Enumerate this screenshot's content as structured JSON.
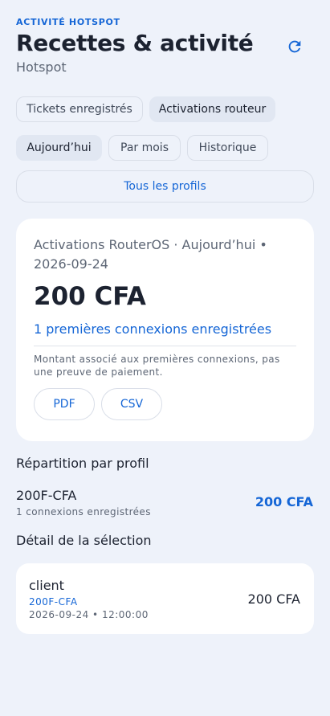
{
  "header": {
    "overline": "ACTIVITÉ HOTSPOT",
    "title": "Recettes & activité",
    "subtitle": "Hotspot",
    "refresh_icon": "refresh-icon"
  },
  "source_tabs": [
    {
      "label": "Tickets enregistrés",
      "active": false
    },
    {
      "label": "Activations routeur",
      "active": true
    }
  ],
  "period_tabs": [
    {
      "label": "Aujourd’hui",
      "active": true
    },
    {
      "label": "Par mois",
      "active": false
    },
    {
      "label": "Historique",
      "active": false
    }
  ],
  "profile_filter": "Tous les profils",
  "summary": {
    "heading": "Activations RouterOS · Aujourd’hui • 2026-09-24",
    "amount": "200 CFA",
    "count_text": "1 premières connexions enregistrées",
    "note": "Montant associé aux premières connexions, pas une preuve de paiement.",
    "export_pdf": "PDF",
    "export_csv": "CSV"
  },
  "breakdown": {
    "title": "Répartition par profil",
    "rows": [
      {
        "profile": "200F-CFA",
        "count_text": "1 connexions enregistrées",
        "amount": "200 CFA"
      }
    ]
  },
  "details": {
    "title": "Détail de la sélection",
    "rows": [
      {
        "user": "client",
        "profile": "200F-CFA",
        "timestamp": "2026-09-24 • 12:00:00",
        "amount": "200 CFA"
      }
    ]
  },
  "colors": {
    "accent": "#1566d6",
    "background": "#eef2fa",
    "card": "#ffffff"
  }
}
